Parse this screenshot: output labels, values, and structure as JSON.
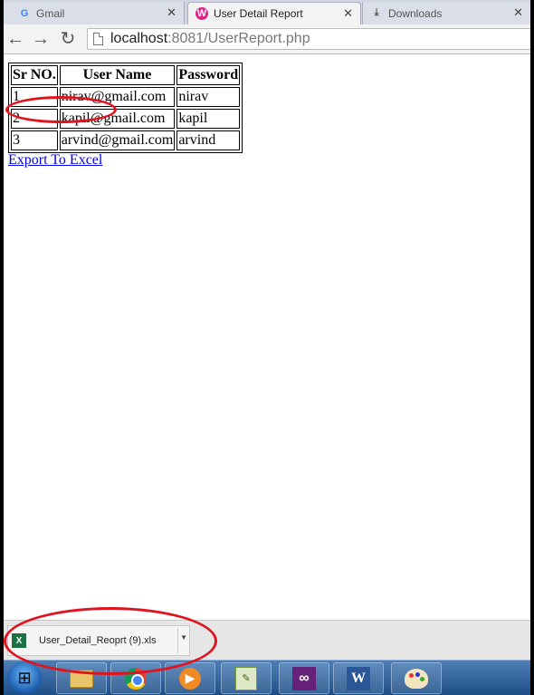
{
  "browser": {
    "tabs": [
      {
        "label": "Gmail",
        "icon": "google-icon",
        "active": false
      },
      {
        "label": "User Detail Report",
        "icon": "wamp-icon",
        "active": true
      },
      {
        "label": "Downloads",
        "icon": "download-icon",
        "active": false
      }
    ],
    "address": {
      "host": "localhost",
      "path": ":8081/UserReport.php"
    }
  },
  "report": {
    "headers": [
      "Sr NO.",
      "User Name",
      "Password"
    ],
    "rows": [
      [
        "1",
        "nirav@gmail.com",
        "nirav"
      ],
      [
        "2",
        "kapil@gmail.com",
        "kapil"
      ],
      [
        "3",
        "arvind@gmail.com",
        "arvind"
      ]
    ],
    "export_label": "Export To Excel"
  },
  "downloads": {
    "file_name": "User_Detail_Reoprt (9).xls",
    "icon": "excel-file-icon"
  },
  "taskbar": {
    "apps": [
      "windows-explorer-icon",
      "chrome-icon",
      "media-player-icon",
      "notepad-plus-plus-icon",
      "visual-studio-icon",
      "word-icon",
      "paint-icon"
    ]
  },
  "annotation_color": "#e0141e"
}
